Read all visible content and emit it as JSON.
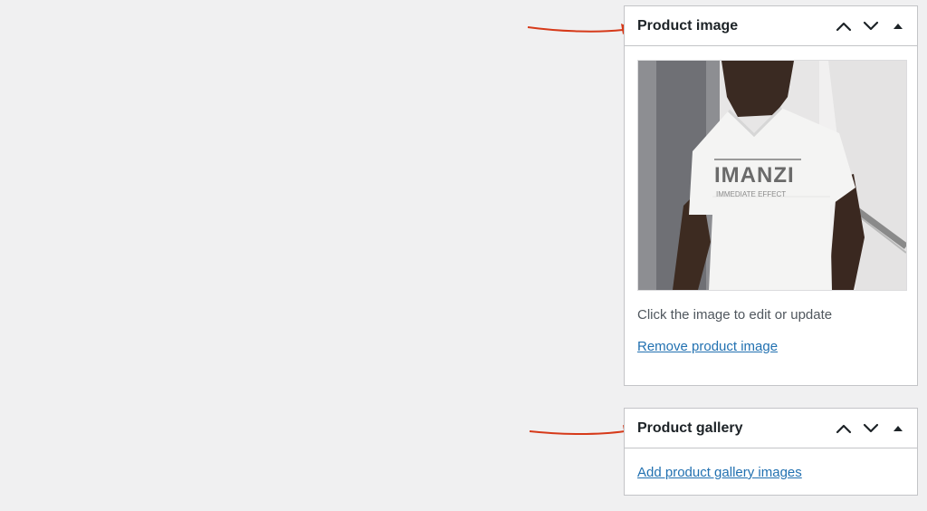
{
  "product_image_box": {
    "title": "Product image",
    "move_up_label": "Move up",
    "move_down_label": "Move down",
    "toggle_label": "Toggle panel",
    "help_text": "Click the image to edit or update",
    "remove_link": "Remove product image",
    "image_alt": "Man wearing white t-shirt with IMANZI print",
    "shirt_print_main": "IMANZI",
    "shirt_print_sub": "IMMEDIATE EFFECT"
  },
  "product_gallery_box": {
    "title": "Product gallery",
    "add_link": "Add product gallery images"
  },
  "colors": {
    "page_background": "#f0f0f1",
    "link": "#2271b1",
    "annotation_arrow": "#d63a1a"
  },
  "icons": {
    "move_up": "chevron-up-icon",
    "move_down": "chevron-down-icon",
    "toggle": "triangle-up-icon",
    "annotation": "arrow-right-annotation"
  }
}
